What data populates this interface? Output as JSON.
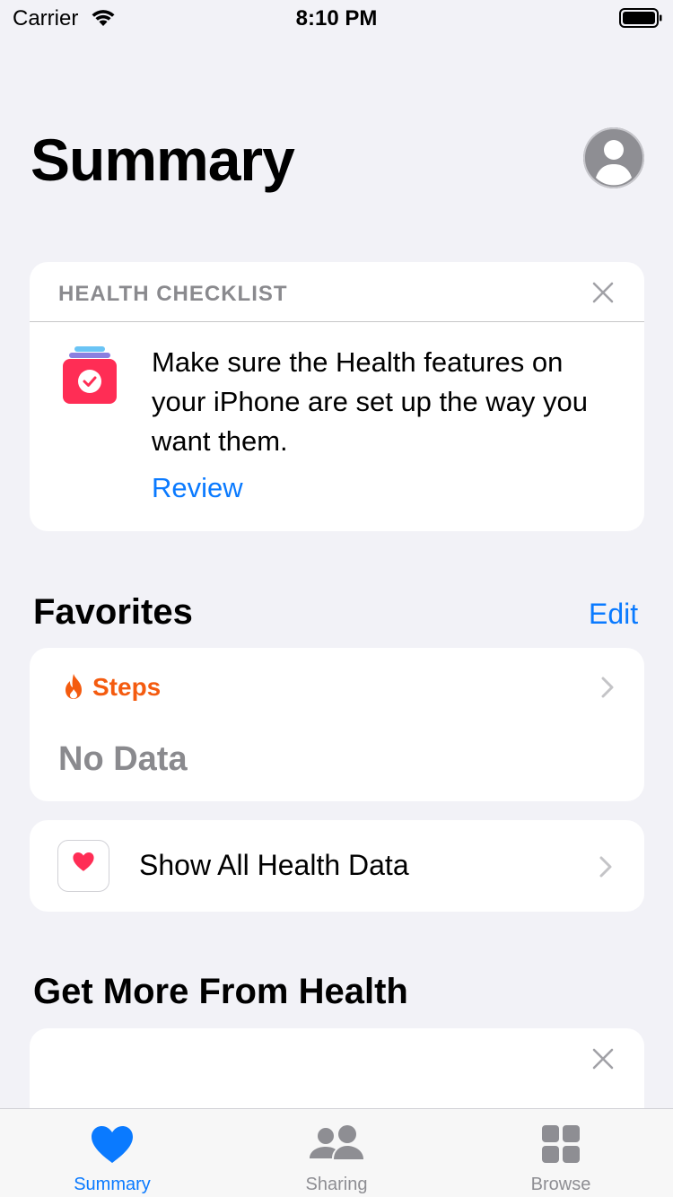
{
  "status_bar": {
    "carrier": "Carrier",
    "time": "8:10 PM"
  },
  "header": {
    "title": "Summary"
  },
  "checklist": {
    "title": "HEALTH CHECKLIST",
    "message": "Make sure the Health features on your iPhone are set up the way you want them.",
    "action": "Review"
  },
  "favorites": {
    "title": "Favorites",
    "edit_label": "Edit",
    "steps_label": "Steps",
    "steps_value": "No Data"
  },
  "show_all": {
    "label": "Show All Health Data"
  },
  "get_more": {
    "title": "Get More From Health"
  },
  "tab_bar": {
    "tabs": [
      {
        "label": "Summary",
        "icon": "heart-icon",
        "selected": true
      },
      {
        "label": "Sharing",
        "icon": "people-icon",
        "selected": false
      },
      {
        "label": "Browse",
        "icon": "grid-icon",
        "selected": false
      }
    ]
  },
  "colors": {
    "accent": "#0a7aff",
    "steps": "#f45b0f",
    "heart": "#ff2d55",
    "background": "#f2f2f7"
  }
}
